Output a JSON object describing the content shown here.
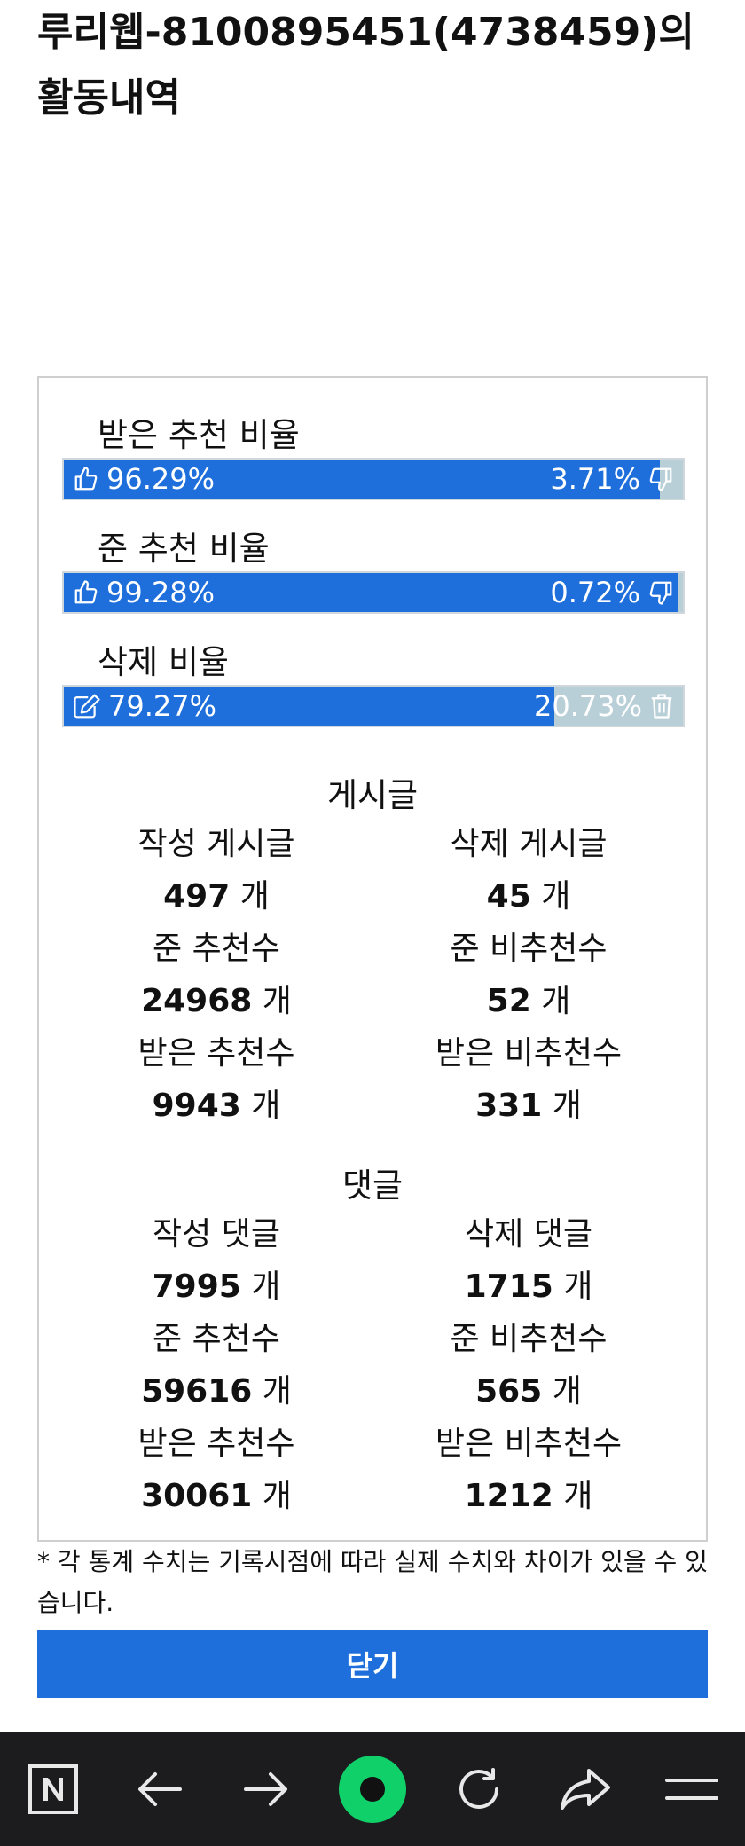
{
  "page": {
    "title": "루리웹-8100895451(4738459)의 활동내역"
  },
  "ratios": {
    "received": {
      "label": "받은 추천 비율",
      "up": "96.29%",
      "down": "3.71%",
      "up_fraction": 0.9629,
      "up_icon": "thumbs-up-icon",
      "down_icon": "thumbs-down-icon"
    },
    "given": {
      "label": "준 추천 비율",
      "up": "99.28%",
      "down": "0.72%",
      "up_fraction": 0.9928,
      "up_icon": "thumbs-up-icon",
      "down_icon": "thumbs-down-icon"
    },
    "deleted": {
      "label": "삭제 비율",
      "kept": "79.27%",
      "deleted": "20.73%",
      "kept_fraction": 0.7927,
      "kept_icon": "edit-icon",
      "deleted_icon": "trash-icon"
    }
  },
  "posts": {
    "title": "게시글",
    "written_label": "작성 게시글",
    "written_value": "497",
    "deleted_label": "삭제 게시글",
    "deleted_value": "45",
    "given_up_label": "준 추천수",
    "given_up_value": "24968",
    "given_down_label": "준 비추천수",
    "given_down_value": "52",
    "received_up_label": "받은 추천수",
    "received_up_value": "9943",
    "received_down_label": "받은 비추천수",
    "received_down_value": "331"
  },
  "comments": {
    "title": "댓글",
    "written_label": "작성 댓글",
    "written_value": "7995",
    "deleted_label": "삭제 댓글",
    "deleted_value": "1715",
    "given_up_label": "준 추천수",
    "given_up_value": "59616",
    "given_down_label": "준 비추천수",
    "given_down_value": "565",
    "received_up_label": "받은 추천수",
    "received_up_value": "30061",
    "received_down_label": "받은 비추천수",
    "received_down_value": "1212"
  },
  "unit": "개",
  "note": "* 각 통계 수치는 기록시점에 따라 실제 수치와 차이가 있을 수 있습니다.",
  "close_label": "닫기",
  "colors": {
    "accent": "#1e6fdc",
    "bar_remainder": "#b9cfd8",
    "nav_background": "#1c1c1f",
    "nav_green": "#10d06a"
  },
  "navbar": {
    "items": [
      "naver-n-icon",
      "back-arrow-icon",
      "forward-arrow-icon",
      "green-dot-icon",
      "refresh-icon",
      "share-icon",
      "menu-icon"
    ]
  }
}
